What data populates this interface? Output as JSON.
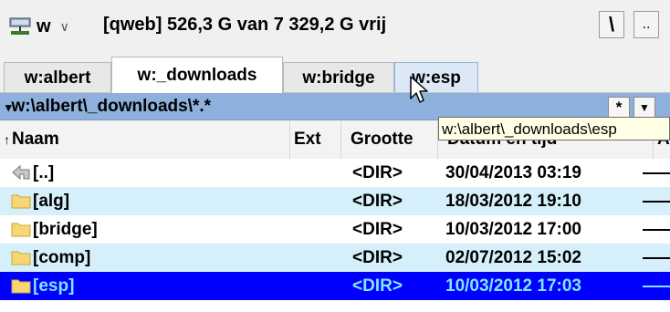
{
  "drive_bar": {
    "drive_letter": "w",
    "drive_info": "[qweb]  526,3 G van 7 329,2 G vrij",
    "root_button": "\\",
    "parent_button": ".."
  },
  "tabs": [
    {
      "label": "w:albert"
    },
    {
      "label": "w:_downloads"
    },
    {
      "label": "w:bridge"
    },
    {
      "label": "w:esp"
    }
  ],
  "path_bar": {
    "path": "w:\\albert\\_downloads\\*.*",
    "hotlist_label": "*",
    "history_label": "▼"
  },
  "columns": {
    "name": "Naam",
    "ext": "Ext",
    "size": "Grootte",
    "date": "Datum en tijd",
    "attr": "Att"
  },
  "rows": [
    {
      "icon": "up-dir-icon",
      "name": "[..]",
      "size": "<DIR>",
      "date": "30/04/2013 03:19"
    },
    {
      "icon": "folder-icon",
      "name": "[alg]",
      "size": "<DIR>",
      "date": "18/03/2012 19:10"
    },
    {
      "icon": "folder-icon",
      "name": "[bridge]",
      "size": "<DIR>",
      "date": "10/03/2012 17:00"
    },
    {
      "icon": "folder-icon",
      "name": "[comp]",
      "size": "<DIR>",
      "date": "02/07/2012 15:02"
    },
    {
      "icon": "folder-icon",
      "name": "[esp]",
      "size": "<DIR>",
      "date": "10/03/2012 17:03"
    }
  ],
  "tooltip": "w:\\albert\\_downloads\\esp",
  "colors": {
    "path_bar": "#8db1dc",
    "row_alt": "#d6f0fb",
    "selection": "#0000ff",
    "selection_text": "#7fe6ff",
    "folder": "#f7d774"
  }
}
